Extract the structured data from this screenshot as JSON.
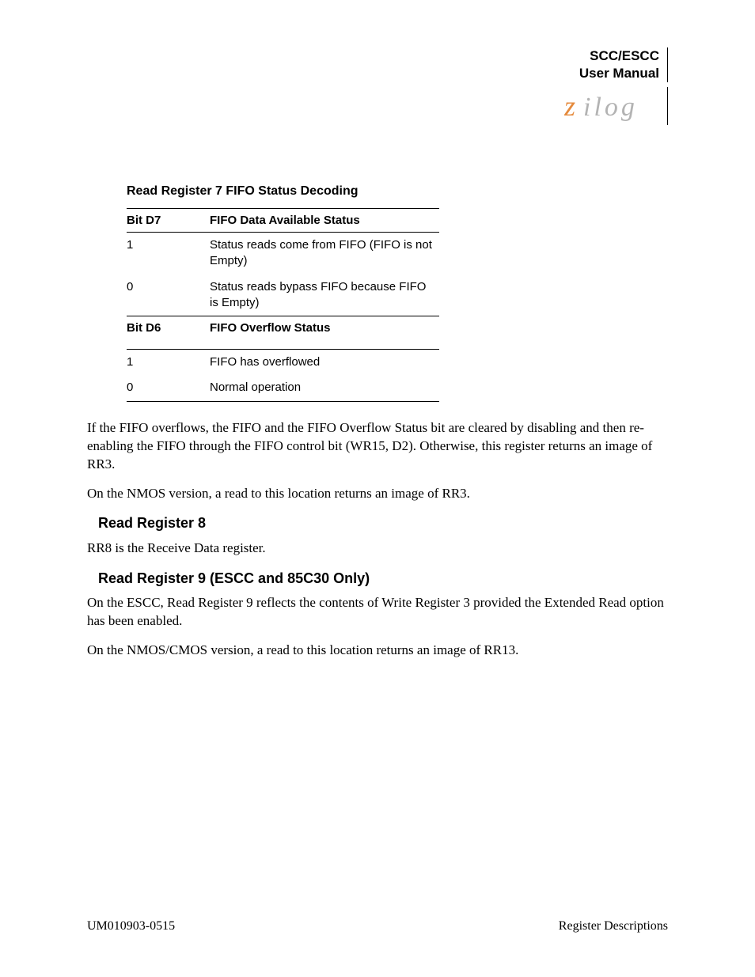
{
  "header": {
    "doc_line1": "SCC/ESCC",
    "doc_line2": "User Manual",
    "logo_text": "zilog",
    "logo_color": "#e58a3c"
  },
  "table": {
    "title": "Read Register 7 FIFO Status Decoding",
    "section1": {
      "col1": "Bit D7",
      "col2": "FIFO Data Available Status",
      "rows": [
        {
          "bit": "1",
          "desc": "Status reads come from FIFO (FIFO is not Empty)"
        },
        {
          "bit": "0",
          "desc": "Status reads bypass FIFO because FIFO is Empty)"
        }
      ]
    },
    "section2": {
      "col1": "Bit D6",
      "col2": "FIFO Overflow Status",
      "rows": [
        {
          "bit": "1",
          "desc": "FIFO has overflowed"
        },
        {
          "bit": "0",
          "desc": "Normal operation"
        }
      ]
    }
  },
  "body": {
    "p1": "If the FIFO overflows, the FIFO and the FIFO Overflow Status bit are cleared by disabling and then re-enabling the FIFO through the FIFO control bit (WR15, D2). Otherwise, this register returns an image of RR3.",
    "p2": "On the NMOS version, a read to this location returns an image of RR3.",
    "h1": "Read Register 8",
    "p3": "RR8 is the Receive Data register.",
    "h2": "Read Register 9 (ESCC and 85C30 Only)",
    "p4": "On the ESCC, Read Register 9 reflects the contents of Write Register 3 provided the Extended Read option has been enabled.",
    "p5": "On the NMOS/CMOS version, a read to this location returns an image of RR13."
  },
  "footer": {
    "left": "UM010903-0515",
    "right": "Register Descriptions"
  }
}
